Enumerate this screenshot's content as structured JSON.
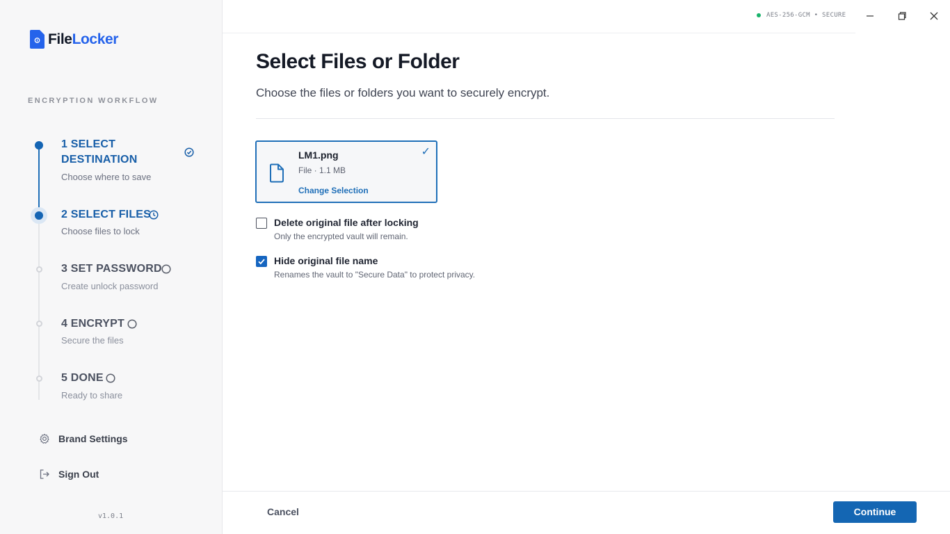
{
  "app": {
    "logo_part1": "File",
    "logo_part2": "Locker",
    "version": "v1.0.1",
    "status": "AES-256-GCM • SECURE"
  },
  "sidebar": {
    "section_label": "ENCRYPTION WORKFLOW",
    "steps": [
      {
        "title_line1": "1 SELECT",
        "title_line2": "DESTINATION",
        "subtitle": "Choose where to save",
        "state": "done"
      },
      {
        "title": "2 SELECT FILES",
        "subtitle": "Choose files to lock",
        "state": "active"
      },
      {
        "title": "3 SET PASSWORD",
        "subtitle": "Create unlock password",
        "state": "todo"
      },
      {
        "title": "4 ENCRYPT",
        "subtitle": "Secure the files",
        "state": "todo"
      },
      {
        "title": "5 DONE",
        "subtitle": "Ready to share",
        "state": "todo"
      }
    ],
    "nav": {
      "brand_settings": "Brand Settings",
      "sign_out": "Sign Out"
    }
  },
  "main": {
    "title": "Select Files or Folder",
    "subtitle": "Choose the files or folders you want to securely encrypt.",
    "file": {
      "name": "LM1.png",
      "meta": "File · 1.1 MB",
      "change_label": "Change Selection",
      "check": "✓"
    },
    "options": [
      {
        "label": "Delete original file after locking",
        "description": "Only the encrypted vault will remain.",
        "checked": false
      },
      {
        "label": "Hide original file name",
        "description": "Renames the vault to \"Secure Data\" to protect privacy.",
        "checked": true
      }
    ]
  },
  "footer": {
    "cancel_label": "Cancel",
    "continue_label": "Continue"
  },
  "colors": {
    "accent": "#1466b3",
    "logo_blue": "#2563eb",
    "status_green": "#19b36b"
  }
}
